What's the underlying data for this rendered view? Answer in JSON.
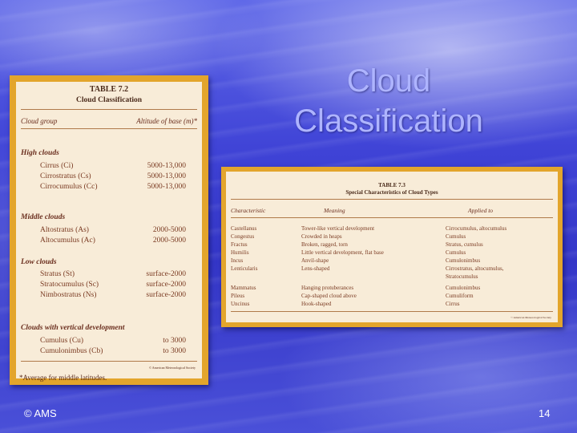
{
  "slide": {
    "title_line1": "Cloud",
    "title_line2": "Classification",
    "footer_left": "© AMS",
    "page_number": "14"
  },
  "table72": {
    "caption1": "TABLE 7.2",
    "caption2": "Cloud Classification",
    "header_left": "Cloud group",
    "header_right": "Altitude of base (m)*",
    "groups": [
      {
        "name": "High clouds",
        "rows": [
          {
            "name": "Cirrus (Ci)",
            "value": "5000-13,000"
          },
          {
            "name": "Cirrostratus (Cs)",
            "value": "5000-13,000"
          },
          {
            "name": "Cirrocumulus (Cc)",
            "value": "5000-13,000"
          }
        ]
      },
      {
        "name": "Middle clouds",
        "rows": [
          {
            "name": "Altostratus (As)",
            "value": "2000-5000"
          },
          {
            "name": "Altocumulus (Ac)",
            "value": "2000-5000"
          }
        ]
      },
      {
        "name": "Low clouds",
        "rows": [
          {
            "name": "Stratus (St)",
            "value": "surface-2000"
          },
          {
            "name": "Stratocumulus (Sc)",
            "value": "surface-2000"
          },
          {
            "name": "Nimbostratus (Ns)",
            "value": "surface-2000"
          }
        ]
      },
      {
        "name": "Clouds with vertical development",
        "rows": [
          {
            "name": "Cumulus (Cu)",
            "value": "to 3000"
          },
          {
            "name": "Cumulonimbus (Cb)",
            "value": "to 3000"
          }
        ]
      }
    ],
    "footnote": "*Average for middle latitudes.",
    "credit": "© American Meteorological Society"
  },
  "table73": {
    "caption1": "TABLE 7.3",
    "caption2": "Special Characteristics of Cloud Types",
    "headers": [
      "Characteristic",
      "Meaning",
      "Applied to"
    ],
    "rows": [
      [
        "Castellanus",
        "Tower-like vertical development",
        "Cirrocumulus, altocumulus"
      ],
      [
        "Congestus",
        "Crowded in heaps",
        "Cumulus"
      ],
      [
        "Fractus",
        "Broken, ragged, torn",
        "Stratus, cumulus"
      ],
      [
        "Humilis",
        "Little vertical development, flat base",
        "Cumulus"
      ],
      [
        "Incus",
        "Anvil-shape",
        "Cumulonimbus"
      ],
      [
        "Lenticularis",
        "Lens-shaped",
        "Cirrostratus, altocumulus,"
      ],
      [
        "",
        "",
        "Stratocumulus"
      ],
      [
        "Mammatus",
        "Hanging protuberances",
        "Cumulonimbus"
      ],
      [
        "Pileus",
        "Cap-shaped cloud above",
        "Cumuliform"
      ],
      [
        "Uncinus",
        "Hook-shaped",
        "Cirrus"
      ]
    ],
    "credit": "© American Meteorological Society"
  }
}
